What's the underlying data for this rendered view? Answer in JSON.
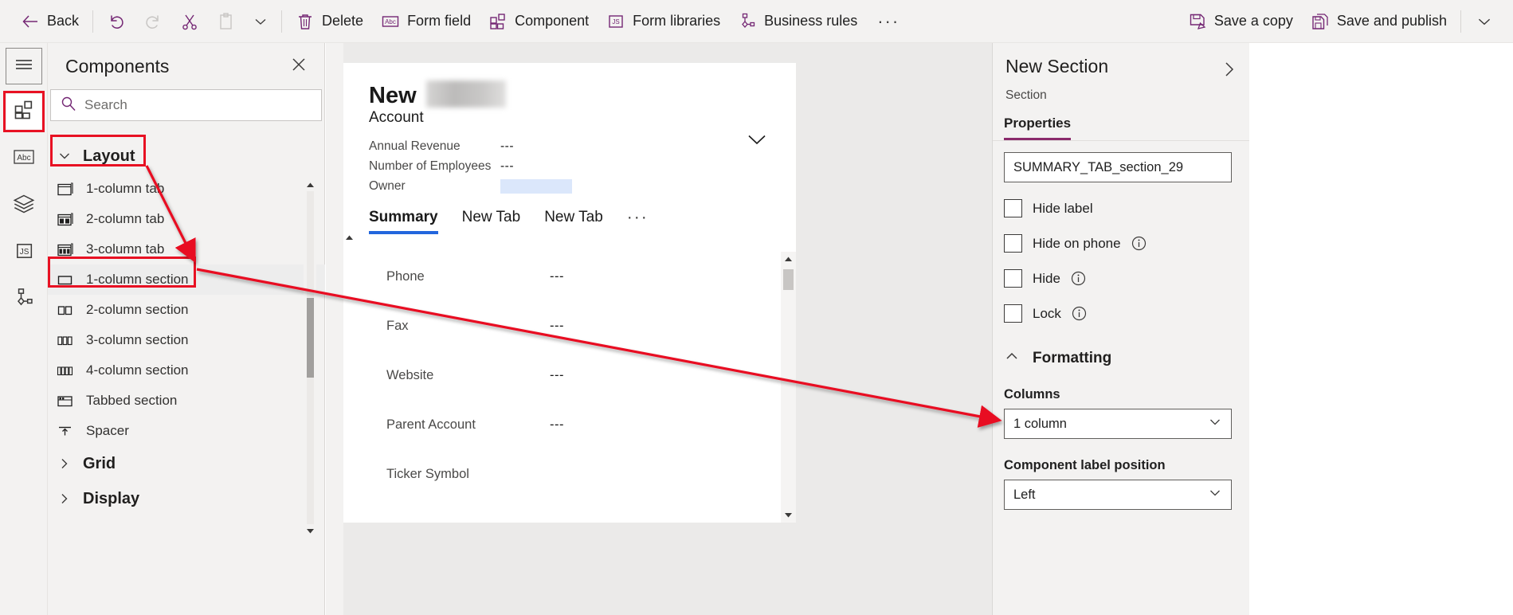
{
  "toolbar": {
    "back": "Back",
    "undo_icon": "undo-icon",
    "redo_icon": "redo-icon",
    "cut_icon": "cut-icon",
    "paste_icon": "paste-icon",
    "more_caret_icon": "chevron-down-icon",
    "delete": "Delete",
    "form_field": "Form field",
    "component": "Component",
    "form_libraries": "Form libraries",
    "business_rules": "Business rules",
    "overflow": "···",
    "save_a_copy": "Save a copy",
    "save_and_publish": "Save and publish",
    "end_caret_icon": "chevron-down-icon"
  },
  "rail": {
    "hamburger_icon": "hamburger-icon",
    "items": [
      {
        "icon": "components-icon",
        "name": "components",
        "active": true
      },
      {
        "icon": "abc-icon",
        "name": "text",
        "active": false
      },
      {
        "icon": "layers-icon",
        "name": "layers",
        "active": false
      },
      {
        "icon": "js-icon",
        "name": "form-libraries",
        "active": false
      },
      {
        "icon": "business-rules-icon",
        "name": "business-rules",
        "active": false
      }
    ]
  },
  "components_panel": {
    "title": "Components",
    "close_icon": "close-icon",
    "search": {
      "placeholder": "Search",
      "value": "",
      "icon": "search-icon"
    },
    "groups": [
      {
        "label": "Layout",
        "expanded": true,
        "chevron": "chevron-down-icon",
        "items": [
          {
            "label": "1-column tab",
            "icon": "one-column-tab-icon"
          },
          {
            "label": "2-column tab",
            "icon": "two-column-tab-icon"
          },
          {
            "label": "3-column tab",
            "icon": "three-column-tab-icon"
          },
          {
            "label": "1-column section",
            "icon": "one-column-section-icon",
            "highlighted": true
          },
          {
            "label": "2-column section",
            "icon": "two-column-section-icon"
          },
          {
            "label": "3-column section",
            "icon": "three-column-section-icon"
          },
          {
            "label": "4-column section",
            "icon": "four-column-section-icon"
          },
          {
            "label": "Tabbed section",
            "icon": "tabbed-section-icon"
          },
          {
            "label": "Spacer",
            "icon": "spacer-icon"
          }
        ]
      },
      {
        "label": "Grid",
        "expanded": false,
        "chevron": "chevron-right-icon",
        "items": []
      },
      {
        "label": "Display",
        "expanded": false,
        "chevron": "chevron-right-icon",
        "items": []
      }
    ]
  },
  "canvas": {
    "form_title": "New",
    "form_title_redacted": "",
    "form_subtitle": "Account",
    "header_fields": [
      {
        "label": "Annual Revenue",
        "value": "---"
      },
      {
        "label": "Number of Employees",
        "value": "---"
      },
      {
        "label": "Owner",
        "value": ""
      }
    ],
    "header_expand_icon": "chevron-down-icon",
    "tabs": [
      {
        "label": "Summary",
        "active": true
      },
      {
        "label": "New Tab",
        "active": false
      },
      {
        "label": "New Tab",
        "active": false
      }
    ],
    "tabs_overflow": "···",
    "body_fields": [
      {
        "label": "Phone",
        "value": "---"
      },
      {
        "label": "Fax",
        "value": "---"
      },
      {
        "label": "Website",
        "value": "---"
      },
      {
        "label": "Parent Account",
        "value": "---"
      },
      {
        "label": "Ticker Symbol",
        "value": ""
      }
    ],
    "scroll_up_icon": "caret-up-icon",
    "scroll_down_icon": "caret-down-icon"
  },
  "properties": {
    "title": "New Section",
    "subtitle": "Section",
    "expand_icon": "chevron-right-icon",
    "tab_label": "Properties",
    "name_field": {
      "value": "SUMMARY_TAB_section_29"
    },
    "checkboxes": [
      {
        "label": "Hide label",
        "checked": false,
        "info": false
      },
      {
        "label": "Hide on phone",
        "checked": false,
        "info": true
      },
      {
        "label": "Hide",
        "checked": false,
        "info": true
      },
      {
        "label": "Lock",
        "checked": false,
        "info": true
      }
    ],
    "formatting": {
      "label": "Formatting",
      "chevron": "chevron-up-icon",
      "columns_label": "Columns",
      "columns_value": "1 column",
      "label_position_label": "Component label position",
      "label_position_value": "Left",
      "dropdown_icon": "chevron-down-icon"
    }
  },
  "colors": {
    "accent_purple": "#742774",
    "annotation_red": "#e81123",
    "tab_underline_blue": "#2266dd",
    "props_tab_underline": "#8a2a6b",
    "panel_bg": "#f3f2f1",
    "canvas_bg": "#ebeae9"
  }
}
